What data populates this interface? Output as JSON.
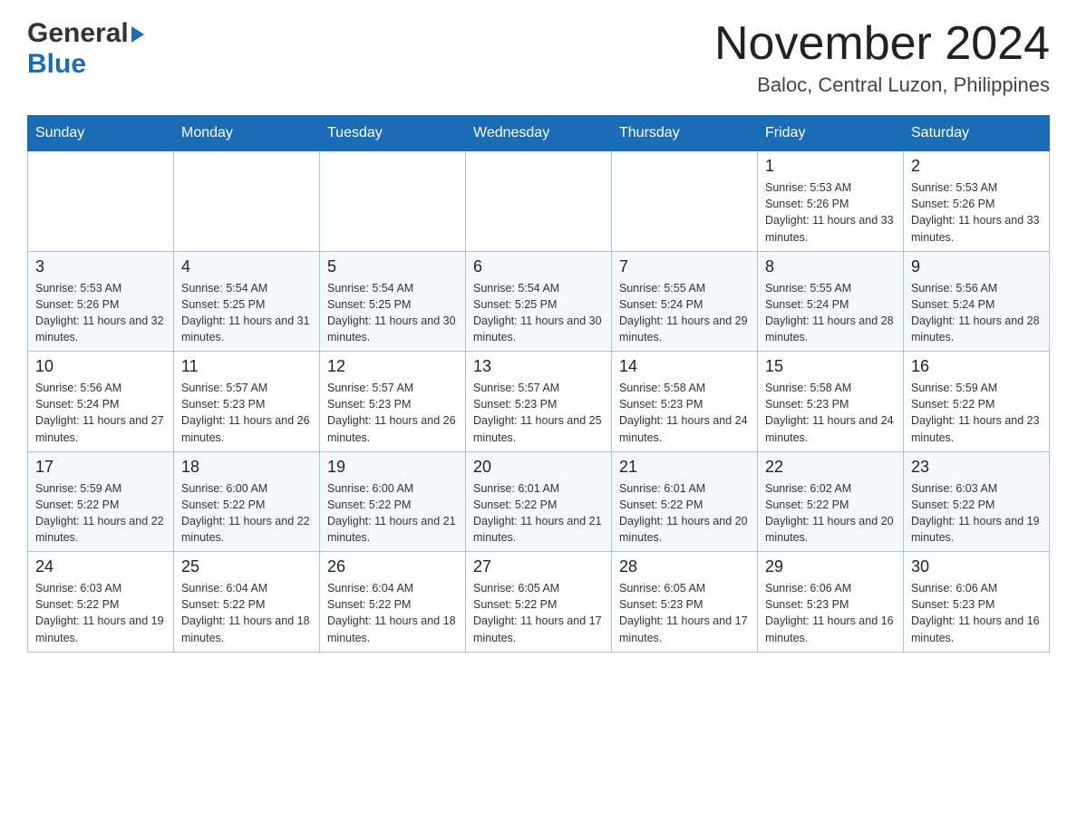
{
  "header": {
    "logo_general": "General",
    "logo_blue": "Blue",
    "month_title": "November 2024",
    "location": "Baloc, Central Luzon, Philippines"
  },
  "weekdays": [
    "Sunday",
    "Monday",
    "Tuesday",
    "Wednesday",
    "Thursday",
    "Friday",
    "Saturday"
  ],
  "weeks": [
    [
      {
        "day": "",
        "sunrise": "",
        "sunset": "",
        "daylight": ""
      },
      {
        "day": "",
        "sunrise": "",
        "sunset": "",
        "daylight": ""
      },
      {
        "day": "",
        "sunrise": "",
        "sunset": "",
        "daylight": ""
      },
      {
        "day": "",
        "sunrise": "",
        "sunset": "",
        "daylight": ""
      },
      {
        "day": "",
        "sunrise": "",
        "sunset": "",
        "daylight": ""
      },
      {
        "day": "1",
        "sunrise": "Sunrise: 5:53 AM",
        "sunset": "Sunset: 5:26 PM",
        "daylight": "Daylight: 11 hours and 33 minutes."
      },
      {
        "day": "2",
        "sunrise": "Sunrise: 5:53 AM",
        "sunset": "Sunset: 5:26 PM",
        "daylight": "Daylight: 11 hours and 33 minutes."
      }
    ],
    [
      {
        "day": "3",
        "sunrise": "Sunrise: 5:53 AM",
        "sunset": "Sunset: 5:26 PM",
        "daylight": "Daylight: 11 hours and 32 minutes."
      },
      {
        "day": "4",
        "sunrise": "Sunrise: 5:54 AM",
        "sunset": "Sunset: 5:25 PM",
        "daylight": "Daylight: 11 hours and 31 minutes."
      },
      {
        "day": "5",
        "sunrise": "Sunrise: 5:54 AM",
        "sunset": "Sunset: 5:25 PM",
        "daylight": "Daylight: 11 hours and 30 minutes."
      },
      {
        "day": "6",
        "sunrise": "Sunrise: 5:54 AM",
        "sunset": "Sunset: 5:25 PM",
        "daylight": "Daylight: 11 hours and 30 minutes."
      },
      {
        "day": "7",
        "sunrise": "Sunrise: 5:55 AM",
        "sunset": "Sunset: 5:24 PM",
        "daylight": "Daylight: 11 hours and 29 minutes."
      },
      {
        "day": "8",
        "sunrise": "Sunrise: 5:55 AM",
        "sunset": "Sunset: 5:24 PM",
        "daylight": "Daylight: 11 hours and 28 minutes."
      },
      {
        "day": "9",
        "sunrise": "Sunrise: 5:56 AM",
        "sunset": "Sunset: 5:24 PM",
        "daylight": "Daylight: 11 hours and 28 minutes."
      }
    ],
    [
      {
        "day": "10",
        "sunrise": "Sunrise: 5:56 AM",
        "sunset": "Sunset: 5:24 PM",
        "daylight": "Daylight: 11 hours and 27 minutes."
      },
      {
        "day": "11",
        "sunrise": "Sunrise: 5:57 AM",
        "sunset": "Sunset: 5:23 PM",
        "daylight": "Daylight: 11 hours and 26 minutes."
      },
      {
        "day": "12",
        "sunrise": "Sunrise: 5:57 AM",
        "sunset": "Sunset: 5:23 PM",
        "daylight": "Daylight: 11 hours and 26 minutes."
      },
      {
        "day": "13",
        "sunrise": "Sunrise: 5:57 AM",
        "sunset": "Sunset: 5:23 PM",
        "daylight": "Daylight: 11 hours and 25 minutes."
      },
      {
        "day": "14",
        "sunrise": "Sunrise: 5:58 AM",
        "sunset": "Sunset: 5:23 PM",
        "daylight": "Daylight: 11 hours and 24 minutes."
      },
      {
        "day": "15",
        "sunrise": "Sunrise: 5:58 AM",
        "sunset": "Sunset: 5:23 PM",
        "daylight": "Daylight: 11 hours and 24 minutes."
      },
      {
        "day": "16",
        "sunrise": "Sunrise: 5:59 AM",
        "sunset": "Sunset: 5:22 PM",
        "daylight": "Daylight: 11 hours and 23 minutes."
      }
    ],
    [
      {
        "day": "17",
        "sunrise": "Sunrise: 5:59 AM",
        "sunset": "Sunset: 5:22 PM",
        "daylight": "Daylight: 11 hours and 22 minutes."
      },
      {
        "day": "18",
        "sunrise": "Sunrise: 6:00 AM",
        "sunset": "Sunset: 5:22 PM",
        "daylight": "Daylight: 11 hours and 22 minutes."
      },
      {
        "day": "19",
        "sunrise": "Sunrise: 6:00 AM",
        "sunset": "Sunset: 5:22 PM",
        "daylight": "Daylight: 11 hours and 21 minutes."
      },
      {
        "day": "20",
        "sunrise": "Sunrise: 6:01 AM",
        "sunset": "Sunset: 5:22 PM",
        "daylight": "Daylight: 11 hours and 21 minutes."
      },
      {
        "day": "21",
        "sunrise": "Sunrise: 6:01 AM",
        "sunset": "Sunset: 5:22 PM",
        "daylight": "Daylight: 11 hours and 20 minutes."
      },
      {
        "day": "22",
        "sunrise": "Sunrise: 6:02 AM",
        "sunset": "Sunset: 5:22 PM",
        "daylight": "Daylight: 11 hours and 20 minutes."
      },
      {
        "day": "23",
        "sunrise": "Sunrise: 6:03 AM",
        "sunset": "Sunset: 5:22 PM",
        "daylight": "Daylight: 11 hours and 19 minutes."
      }
    ],
    [
      {
        "day": "24",
        "sunrise": "Sunrise: 6:03 AM",
        "sunset": "Sunset: 5:22 PM",
        "daylight": "Daylight: 11 hours and 19 minutes."
      },
      {
        "day": "25",
        "sunrise": "Sunrise: 6:04 AM",
        "sunset": "Sunset: 5:22 PM",
        "daylight": "Daylight: 11 hours and 18 minutes."
      },
      {
        "day": "26",
        "sunrise": "Sunrise: 6:04 AM",
        "sunset": "Sunset: 5:22 PM",
        "daylight": "Daylight: 11 hours and 18 minutes."
      },
      {
        "day": "27",
        "sunrise": "Sunrise: 6:05 AM",
        "sunset": "Sunset: 5:22 PM",
        "daylight": "Daylight: 11 hours and 17 minutes."
      },
      {
        "day": "28",
        "sunrise": "Sunrise: 6:05 AM",
        "sunset": "Sunset: 5:23 PM",
        "daylight": "Daylight: 11 hours and 17 minutes."
      },
      {
        "day": "29",
        "sunrise": "Sunrise: 6:06 AM",
        "sunset": "Sunset: 5:23 PM",
        "daylight": "Daylight: 11 hours and 16 minutes."
      },
      {
        "day": "30",
        "sunrise": "Sunrise: 6:06 AM",
        "sunset": "Sunset: 5:23 PM",
        "daylight": "Daylight: 11 hours and 16 minutes."
      }
    ]
  ]
}
